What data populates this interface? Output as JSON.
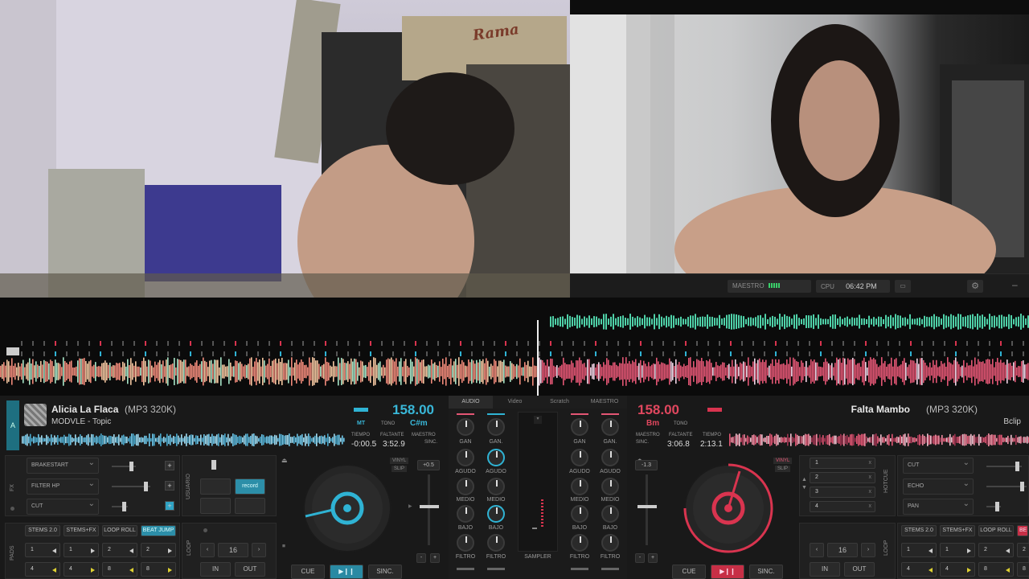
{
  "cam_overlay": {
    "box_brand": "Rama"
  },
  "topbar": {
    "master_label": "MAESTRO",
    "cpu_label": "CPU",
    "clock": "06:42 PM"
  },
  "mixer_tabs": [
    "AUDIO",
    "Video",
    "Scratch",
    "MAESTRO"
  ],
  "deck_a": {
    "letter": "A",
    "title": "Alicia La Flaca",
    "format": "(MP3 320K)",
    "artist": "MODVLE - Topic",
    "bpm": "158.00",
    "mt": "MT",
    "tono_label": "TONO",
    "key": "C#m",
    "tiempo_label": "TIEMPO",
    "faltante_label": "FALTANTE",
    "maestro_label": "MAESTRO",
    "sinc_label": "SINC.",
    "tiempo": "-0:00.5",
    "faltante": "3:52.9",
    "fx": [
      "BRAKESTART",
      "FILTER HP",
      "CUT"
    ],
    "fx_side": "FX",
    "usuario_label": "USUARIO",
    "record_label": "record",
    "vinyl": "VINYL",
    "slip": "SLIP",
    "pitch": "+0.5",
    "pads_label": "PADS",
    "pad_modes": [
      "STEMS 2.0",
      "STEMS+FX",
      "LOOP ROLL",
      "BEAT JUMP"
    ],
    "pads": [
      "1",
      "1",
      "2",
      "2",
      "4",
      "4",
      "8",
      "8"
    ],
    "loop_label": "LOOP",
    "loop_size": "16",
    "in_label": "IN",
    "out_label": "OUT",
    "cue": "CUE",
    "play": "▶❙❙",
    "sync": "SINC."
  },
  "deck_b": {
    "title": "Falta Mambo",
    "format": "(MP3 320K)",
    "artist": "Bclip",
    "bpm": "158.00",
    "key": "Bm",
    "tono_label": "TONO",
    "maestro_label": "MAESTRO",
    "sinc_label": "SINC.",
    "faltante_label": "FALTANTE",
    "tiempo_label": "TIEMPO",
    "faltante": "3:06.8",
    "tiempo": "2:13.1",
    "pitch": "-1.3",
    "vinyl": "VINYL",
    "slip": "SLIP",
    "hotcue_label": "HOTCUE",
    "hotcues": [
      "1",
      "2",
      "3",
      "4"
    ],
    "fx": [
      "CUT",
      "ECHO",
      "PAN"
    ],
    "pad_modes": [
      "STEMS 2.0",
      "STEMS+FX",
      "LOOP ROLL",
      "BE"
    ],
    "pads": [
      "1",
      "1",
      "2",
      "2",
      "4",
      "4",
      "8",
      "8"
    ],
    "loop_label": "LOOP",
    "loop_size": "16",
    "in_label": "IN",
    "out_label": "OUT",
    "cue": "CUE",
    "play": "▶❙❙",
    "sync": "SINC."
  },
  "mixer": {
    "gan": "GAN",
    "gan2": "GAN.",
    "agudo": "AGUDO",
    "medio": "MEDIO",
    "bajo": "BAJO",
    "filtro": "FILTRO",
    "sampler": "SAMPLER"
  },
  "colors": {
    "accent_a": "#2fb3d4",
    "accent_b": "#d9344f",
    "wave_top": "#4fd1a8",
    "wave_a": "#f08a7a",
    "wave_b": "#e35674"
  },
  "icons": [
    "folder-icon",
    "settings-gear-icon",
    "minimize-icon",
    "eject-icon"
  ]
}
